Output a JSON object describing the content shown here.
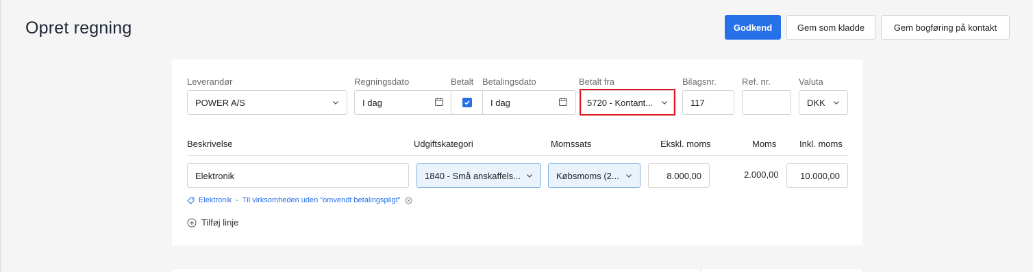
{
  "page": {
    "title": "Opret regning"
  },
  "toolbar": {
    "approve_label": "Godkend",
    "draft_label": "Gem som kladde",
    "save_posting_label": "Gem bogføring på kontakt"
  },
  "form": {
    "supplier": {
      "label": "Leverandør",
      "value": "POWER A/S"
    },
    "invoice_date": {
      "label": "Regningsdato",
      "value": "I dag"
    },
    "paid": {
      "label": "Betalt",
      "checked": true
    },
    "payment_date": {
      "label": "Betalingsdato",
      "value": "I dag"
    },
    "paid_from": {
      "label": "Betalt fra",
      "value": "5720 - Kontant..."
    },
    "voucher_no": {
      "label": "Bilagsnr.",
      "value": "117"
    },
    "ref_no": {
      "label": "Ref. nr.",
      "value": ""
    },
    "currency": {
      "label": "Valuta",
      "value": "DKK"
    }
  },
  "lines": {
    "headers": {
      "description": "Beskrivelse",
      "expense_category": "Udgiftskategori",
      "vat_rate": "Momssats",
      "excl_vat": "Ekskl. moms",
      "vat": "Moms",
      "incl_vat": "Inkl. moms"
    },
    "rows": [
      {
        "description": "Elektronik",
        "expense_category": "1840 - Små anskaffels...",
        "vat_rate": "Købsmoms (2...",
        "excl_vat": "8.000,00",
        "vat": "2.000,00",
        "incl_vat": "10.000,00"
      }
    ],
    "tag_text": "Elektronik",
    "tag_separator": "-",
    "tag_note": "Til virksomheden uden \"omvendt betalingspligt\"",
    "add_line_label": "Tilføj linje"
  },
  "colors": {
    "accent": "#2670e8",
    "highlight": "#e0141e"
  }
}
